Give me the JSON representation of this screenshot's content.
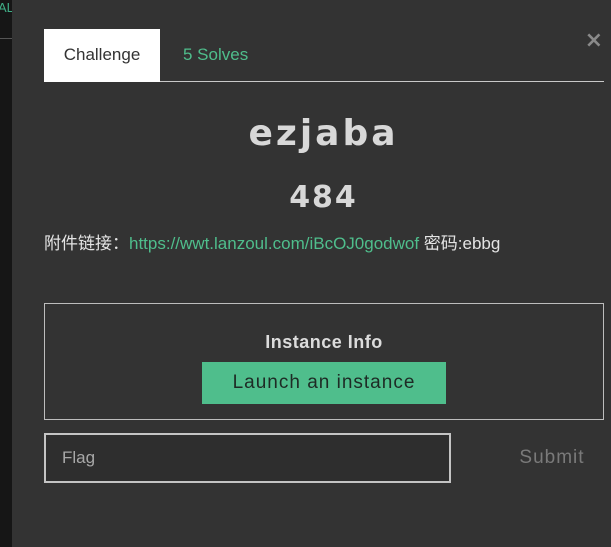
{
  "backdrop": {
    "fragment_text": "AL"
  },
  "modal": {
    "close_label": "×",
    "tabs": [
      {
        "label": "Challenge"
      },
      {
        "label": "5 Solves"
      }
    ],
    "challenge": {
      "name": "ezjaba",
      "points": "484",
      "description_prefix": "附件链接：",
      "attachment_link": "https://wwt.lanzoul.com/iBcOJ0godwof",
      "description_suffix": " 密码:ebbg"
    },
    "instance": {
      "title": "Instance Info",
      "launch_label": "Launch an instance"
    },
    "flag": {
      "placeholder": "Flag",
      "value": "",
      "submit_label": "Submit"
    }
  },
  "colors": {
    "accent": "#4fbe8c",
    "modal_bg": "#333333",
    "backdrop": "#161616"
  }
}
